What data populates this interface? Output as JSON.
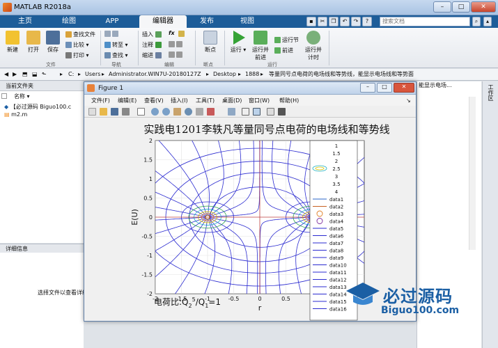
{
  "app": {
    "title": "MATLAB R2018a"
  },
  "tabs": [
    {
      "label": "主页"
    },
    {
      "label": "绘图"
    },
    {
      "label": "APP"
    },
    {
      "label": "编辑器"
    },
    {
      "label": "发布"
    },
    {
      "label": "视图"
    }
  ],
  "search_placeholder": "搜索文档",
  "ribbon": {
    "new": "新建",
    "open": "打开",
    "save": "保存",
    "find_files": "查找文件",
    "compare": "比较",
    "print": "打印",
    "goto": "转至",
    "find": "查找",
    "insert": "插入",
    "comment": "注释",
    "indent": "缩进",
    "fx": "fx",
    "breakpoints": "断点",
    "run": "运行",
    "run_advance": [
      "运行并",
      "前进"
    ],
    "run_section": "运行节",
    "advance": "前进",
    "run_time": [
      "运行并",
      "计时"
    ],
    "group_file": "文件",
    "group_nav": "导航",
    "group_edit": "编辑",
    "group_bp": "断点",
    "group_run": "运行"
  },
  "address": {
    "parts": [
      "C:",
      "Users",
      "Administrator.WIN7U-20180127Z",
      "Desktop",
      "1888",
      "等量同号点电荷的电场线和等势线，能显示电场线和等势面"
    ]
  },
  "left_panel": {
    "title": "当前文件夹",
    "col_name": "名称",
    "files": [
      "【必过源码 Biguo100.c",
      "m2.m"
    ],
    "detail_title": "详细信息",
    "detail_msg": "选择文件以查看详细信息"
  },
  "right_panel": {
    "text": "能显示电场...",
    "workspace": "工作区"
  },
  "figure": {
    "title": "Figure 1",
    "menu": [
      "文件(F)",
      "编辑(E)",
      "查看(V)",
      "插入(I)",
      "工具(T)",
      "桌面(D)",
      "窗口(W)",
      "帮助(H)"
    ],
    "plot_title": "实践电1201李轶凡等量同号点电荷的电场线和等势线",
    "annotation": "电荷比:Q",
    "annotation_sub": "2",
    "annotation_sup": "5",
    "annotation_mid": "/Q",
    "annotation_sub2": "1",
    "annotation_end": "=1",
    "ylabel": "E(U)",
    "xlabel": "r"
  },
  "chart_data": {
    "type": "line",
    "title": "实践电1201李轶凡等量同号点电荷的电场线和等势线",
    "xlabel": "r",
    "ylabel": "E(U)",
    "xlim": [
      -2,
      2
    ],
    "ylim": [
      -2,
      2
    ],
    "x_ticks": [
      "-2",
      "-1.5",
      "-1",
      "-0.5",
      "0",
      "0.5",
      "1"
    ],
    "y_ticks": [
      "-2",
      "-1.5",
      "-1",
      "-0.5",
      "0",
      "0.5",
      "1",
      "1.5",
      "2"
    ],
    "charges": [
      {
        "x": -1,
        "y": 0
      },
      {
        "x": 1,
        "y": 0
      }
    ],
    "legend": [
      "1",
      "1.5",
      "2",
      "2.5",
      "3",
      "3.5",
      "4",
      "data1",
      "data2",
      "data3",
      "data4",
      "data5",
      "data6",
      "data7",
      "data8",
      "data9",
      "data10",
      "data11",
      "data12",
      "data13",
      "data14",
      "data15",
      "data16"
    ],
    "grid": true,
    "legend_placement": "right"
  },
  "watermark": {
    "text": "必过源码",
    "sub": "Biguo100.com"
  },
  "colors": {
    "ribbon_tab": "#1d5d99",
    "field_line": "#2a2ad0",
    "equipotential_orange": "#e07b20",
    "equipotential_yellow": "#d6c400",
    "equipotential_cyan": "#1fb0c0",
    "equipotential_green": "#2aa44a"
  }
}
